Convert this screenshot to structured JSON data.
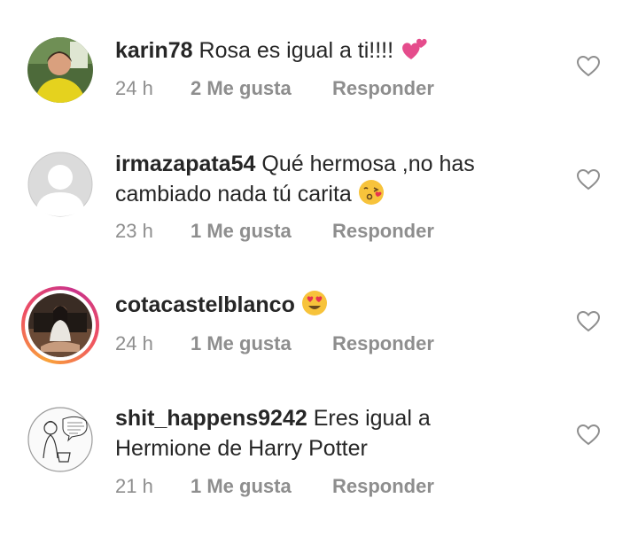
{
  "comments": [
    {
      "username": "karin78",
      "text": "Rosa es igual a ti!!!!",
      "emoji": "two-hearts",
      "time": "24 h",
      "likes": "2 Me gusta",
      "reply": "Responder"
    },
    {
      "username": "irmazapata54",
      "text": "Qué hermosa ,no has cambiado nada tú carita",
      "emoji": "face-blowing-kiss",
      "time": "23 h",
      "likes": "1 Me gusta",
      "reply": "Responder"
    },
    {
      "username": "cotacastelblanco",
      "text": "",
      "emoji": "heart-eyes",
      "time": "24 h",
      "likes": "1 Me gusta",
      "reply": "Responder"
    },
    {
      "username": "shit_happens9242",
      "text": "Eres igual a Hermione de Harry Potter",
      "emoji": "",
      "time": "21 h",
      "likes": "1 Me gusta",
      "reply": "Responder"
    }
  ],
  "icons": {
    "like": "heart-outline-icon"
  },
  "colors": {
    "text": "#262626",
    "meta": "#8e8e8e",
    "heart_outline": "#8e8e8e"
  }
}
